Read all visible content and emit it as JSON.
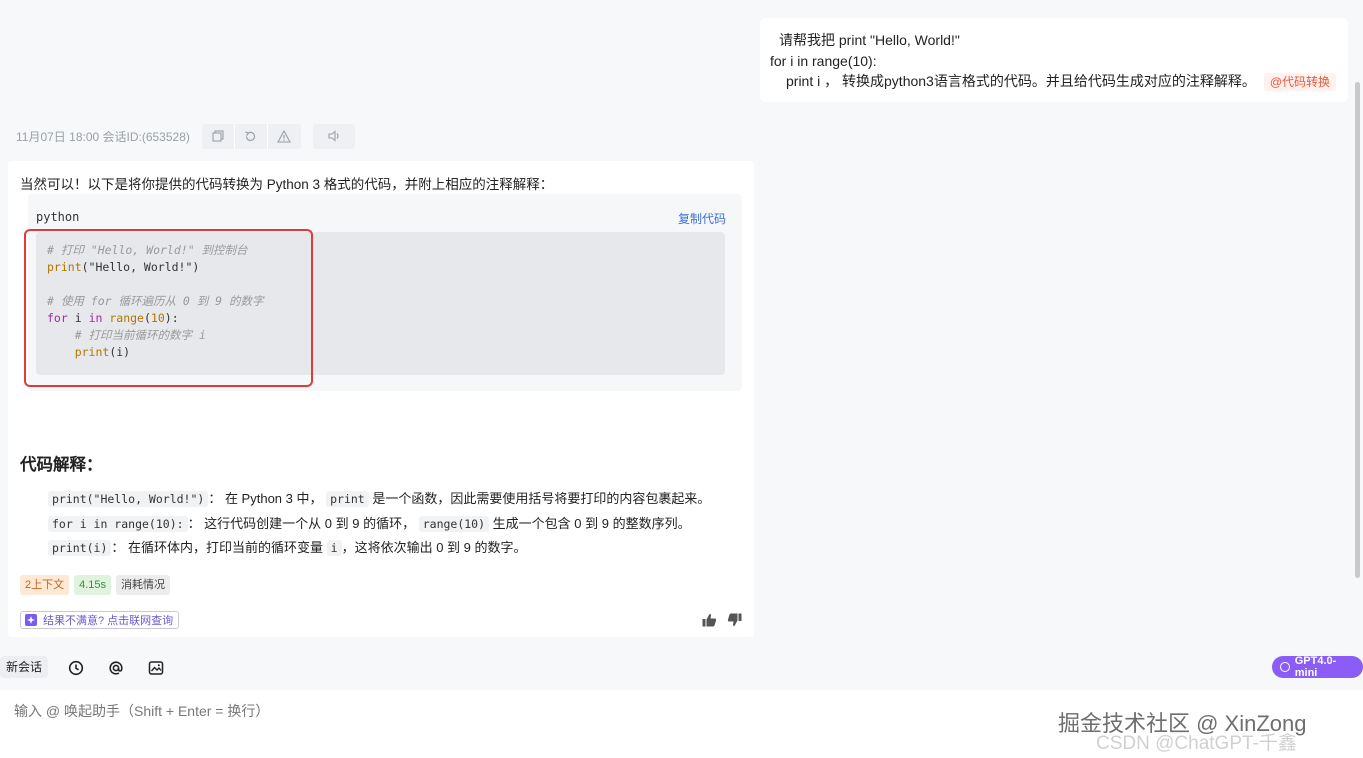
{
  "user_message": {
    "line1": "请帮我把   print \"Hello, World!\"",
    "line2": "for i in range(10):",
    "line3": "print i  ， 转换成python3语言格式的代码。并且给代码生成对应的注释解释。",
    "tag": "@代码转换"
  },
  "meta": {
    "text": "11月07日 18:00 会话ID:(653528)",
    "icons": [
      "copy-icon",
      "refresh-icon",
      "warning-icon",
      "speaker-icon"
    ]
  },
  "answer": {
    "intro": "当然可以！以下是将你提供的代码转换为 Python 3 格式的代码，并附上相应的注释解释：",
    "code_lang": "python",
    "copy_label": "复制代码",
    "code_lines": [
      "# 打印 \"Hello, World!\" 到控制台",
      "print(\"Hello, World!\")",
      "",
      "# 使用 for 循环遍历从 0 到 9 的数字",
      "for i in range(10):",
      "    # 打印当前循环的数字 i",
      "    print(i)"
    ],
    "section_title": "代码解释：",
    "explanations": [
      {
        "code": "print(\"Hello, World!\")",
        "sep": "： 在 Python 3 中，",
        "code2": "print",
        "text": "是一个函数，因此需要使用括号将要打印的内容包裹起来。"
      },
      {
        "code": "for i in range(10):",
        "sep": "： 这行代码创建一个从 0 到 9 的循环，",
        "code2": "range(10)",
        "text": "生成一个包含 0 到 9 的整数序列。"
      },
      {
        "code": "print(i)",
        "sep": "： 在循环体内，打印当前的循环变量",
        "code2": "i",
        "text": "，这将依次输出 0 到 9 的数字。"
      }
    ],
    "badges": {
      "context": "2上下文",
      "time": "4.15s",
      "usage": "消耗情况"
    },
    "web_query": "结果不满意? 点击联网查询"
  },
  "toolbar": {
    "new_chat": "新会话",
    "model": "GPT4.0-mini"
  },
  "input": {
    "placeholder": "输入 @ 唤起助手（Shift + Enter = 换行）"
  },
  "watermark": {
    "line1": "掘金技术社区 @ XinZong",
    "line2": "CSDN @ChatGPT-千鑫"
  },
  "colors": {
    "accent": "#8b5cf6",
    "highlight_box": "#e03a3a",
    "link": "#3b6fd9",
    "tag": "#e5593d"
  }
}
